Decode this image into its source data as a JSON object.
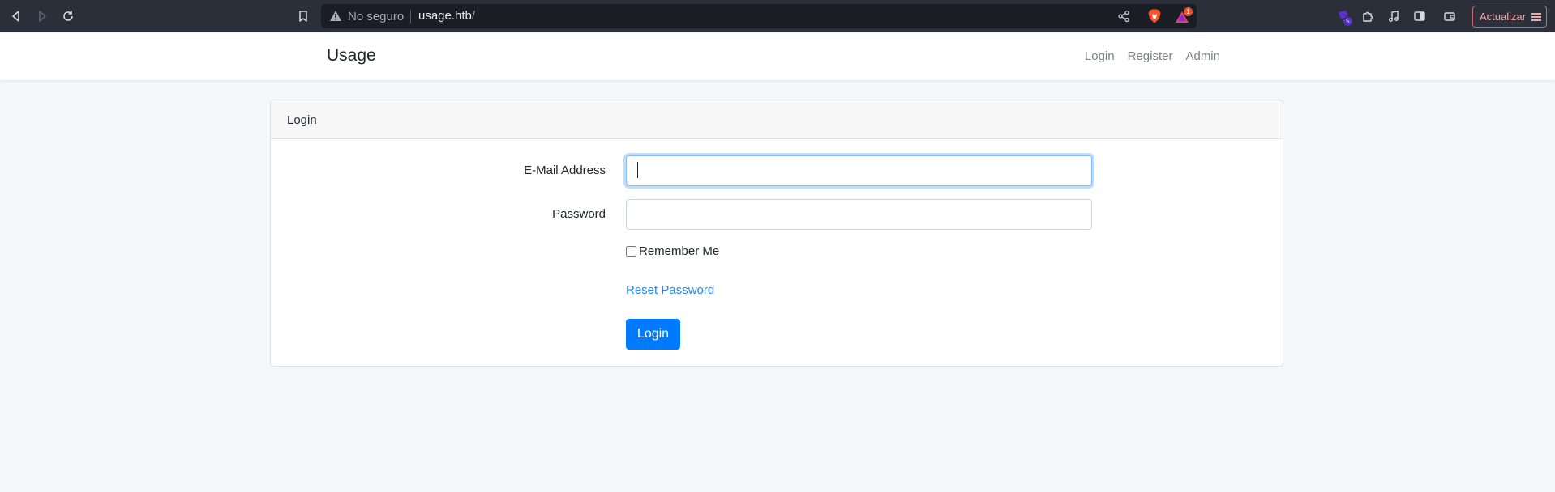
{
  "browser": {
    "security_label": "No seguro",
    "url_host": "usage.htb",
    "url_path": "/",
    "brave_badge": "1",
    "extension_badge": "5",
    "update_button_label": "Actualizar",
    "colors": {
      "chrome_bg": "#2b2f3a",
      "urlbar_bg": "#1b1d24",
      "update_accent": "#f0a9a9"
    }
  },
  "navbar": {
    "brand": "Usage",
    "links": [
      "Login",
      "Register",
      "Admin"
    ]
  },
  "login_card": {
    "header": "Login",
    "email_label": "E-Mail Address",
    "email_value": "",
    "password_label": "Password",
    "password_value": "",
    "remember_label": "Remember Me",
    "remember_checked": false,
    "reset_link": "Reset Password",
    "submit_label": "Login",
    "colors": {
      "primary": "#007bff",
      "link": "#1f87f5"
    }
  }
}
